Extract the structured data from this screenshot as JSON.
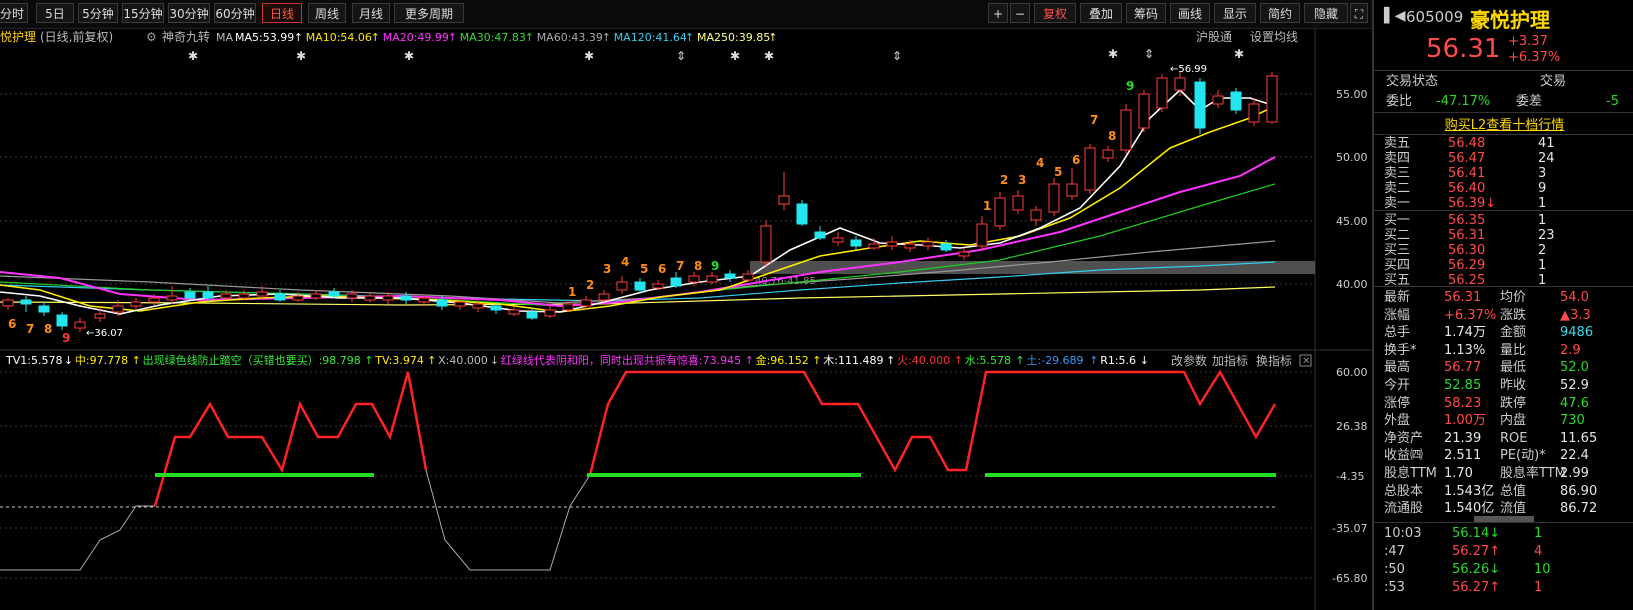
{
  "toolbar": {
    "periods": [
      "分时",
      "5日",
      "5分钟",
      "15分钟",
      "30分钟",
      "60分钟",
      "日线",
      "周线",
      "月线",
      "更多周期"
    ],
    "active_period": "日线",
    "right": [
      "+",
      "−",
      "复权",
      "叠加",
      "筹码",
      "画线",
      "显示",
      "简约",
      "隐藏"
    ]
  },
  "kline_header": {
    "stock": "悦护理",
    "mode": "(日线,前复权)",
    "indicator": "神奇九转",
    "ma_label": "MA",
    "ma_items": [
      {
        "text": "MA5:53.99",
        "color": "#ffffff"
      },
      {
        "text": "MA10:54.06",
        "color": "#ffe600"
      },
      {
        "text": "MA20:49.99",
        "color": "#ff33ff"
      },
      {
        "text": "MA30:47.83",
        "color": "#33dd33"
      },
      {
        "text": "MA60:43.39",
        "color": "#aaaaaa"
      },
      {
        "text": "MA120:41.64",
        "color": "#33ccee"
      },
      {
        "text": "MA250:39.85",
        "color": "#ffff88"
      }
    ],
    "market": "沪股通",
    "settings": "设置均线"
  },
  "price_axis": [
    "55.00",
    "50.00",
    "45.00",
    "40.00"
  ],
  "annotations": {
    "high": "56.99",
    "low": "36.07",
    "zone": "40.76-41.85"
  },
  "nine_top": [
    "1",
    "2",
    "3",
    "4",
    "5",
    "6",
    "7",
    "8",
    "9"
  ],
  "nine_bottom": [
    "6",
    "7",
    "8",
    "9"
  ],
  "indicator_header": [
    {
      "text": "TV1:5.578",
      "color": "#ffffff"
    },
    {
      "text": "中:97.778",
      "color": "#ffee00"
    },
    {
      "text": "出现绿色线防止踏空（买错也要买）:98.798",
      "color": "#33ee33"
    },
    {
      "text": "TV:3.974",
      "color": "#ffee00"
    },
    {
      "text": "X:40.000",
      "color": "#bbbbbb"
    },
    {
      "text": "红绿线代表阴和阳，同时出现共振有惊喜:73.945",
      "color": "#ff33ff"
    },
    {
      "text": "金:96.152",
      "color": "#ffee00"
    },
    {
      "text": "木:111.489",
      "color": "#ffffff"
    },
    {
      "text": "火:40.000",
      "color": "#ff3333"
    },
    {
      "text": "水:5.578",
      "color": "#33ee33"
    },
    {
      "text": "土:-29.689",
      "color": "#3399ff"
    },
    {
      "text": "R1:5.6",
      "color": "#ffffff"
    }
  ],
  "indicator_buttons": [
    "改参数",
    "加指标",
    "换指标"
  ],
  "indicator_axis": [
    "60.00",
    "26.38",
    "-4.35",
    "-35.07",
    "-65.80"
  ],
  "quote": {
    "code": "605009",
    "name": "豪悦护理",
    "price": "56.31",
    "change": "+3.37",
    "change_pct": "+6.37%",
    "status_label": "交易状态",
    "status_value": "交易",
    "weibi_label": "委比",
    "weibi_value": "-47.17%",
    "weicha_label": "委差",
    "weicha_value": "-5",
    "l2_link": "购买L2查看十档行情",
    "sell": [
      {
        "label": "卖五",
        "price": "56.48",
        "vol": "41"
      },
      {
        "label": "卖四",
        "price": "56.47",
        "vol": "24"
      },
      {
        "label": "卖三",
        "price": "56.41",
        "vol": "3"
      },
      {
        "label": "卖二",
        "price": "56.40",
        "vol": "9"
      },
      {
        "label": "卖一",
        "price": "56.39↓",
        "vol": "1"
      }
    ],
    "buy": [
      {
        "label": "买一",
        "price": "56.35",
        "vol": "1"
      },
      {
        "label": "买二",
        "price": "56.31",
        "vol": "23"
      },
      {
        "label": "买三",
        "price": "56.30",
        "vol": "2"
      },
      {
        "label": "买四",
        "price": "56.29",
        "vol": "1"
      },
      {
        "label": "买五",
        "price": "56.25",
        "vol": "1"
      }
    ],
    "stats": [
      {
        "l1": "最新",
        "v1": "56.31",
        "c1": "red",
        "l2": "均价",
        "v2": "54.0",
        "c2": "red"
      },
      {
        "l1": "涨幅",
        "v1": "+6.37%",
        "c1": "red",
        "l2": "涨跌",
        "v2": "▲3.3",
        "c2": "red"
      },
      {
        "l1": "总手",
        "v1": "1.74万",
        "c1": "white",
        "l2": "金额",
        "v2": "9486",
        "c2": "cyan"
      },
      {
        "l1": "换手*",
        "v1": "1.13%",
        "c1": "white",
        "l2": "量比",
        "v2": "2.9",
        "c2": "red"
      },
      {
        "l1": "最高",
        "v1": "56.77",
        "c1": "red",
        "l2": "最低",
        "v2": "52.0",
        "c2": "green"
      },
      {
        "l1": "今开",
        "v1": "52.85",
        "c1": "green",
        "l2": "昨收",
        "v2": "52.9",
        "c2": "white"
      },
      {
        "l1": "涨停",
        "v1": "58.23",
        "c1": "red",
        "l2": "跌停",
        "v2": "47.6",
        "c2": "green"
      },
      {
        "l1": "外盘",
        "v1": "1.00万",
        "c1": "red",
        "l2": "内盘",
        "v2": "730",
        "c2": "green"
      },
      {
        "l1": "净资产",
        "v1": "21.39",
        "c1": "white",
        "l2": "ROE",
        "v2": "11.65",
        "c2": "white"
      },
      {
        "l1": "收益㈣",
        "v1": "2.511",
        "c1": "white",
        "l2": "PE(动)*",
        "v2": "22.4",
        "c2": "white"
      },
      {
        "l1": "股息TTM",
        "v1": "1.70",
        "c1": "white",
        "l2": "股息率TTM",
        "v2": "2.99",
        "c2": "white"
      },
      {
        "l1": "总股本",
        "v1": "1.543亿",
        "c1": "white",
        "l2": "总值",
        "v2": "86.90",
        "c2": "white"
      },
      {
        "l1": "流通股",
        "v1": "1.540亿",
        "c1": "white",
        "l2": "流值",
        "v2": "86.72",
        "c2": "white"
      }
    ],
    "ticks": [
      {
        "time": "10:03",
        "price": "56.14↓",
        "vol": "1",
        "pc": "green"
      },
      {
        "time": ":47",
        "price": "56.27↑",
        "vol": "4",
        "pc": "red"
      },
      {
        "time": ":50",
        "price": "56.26↓",
        "vol": "10",
        "pc": "green"
      },
      {
        "time": ":53",
        "price": "56.27↑",
        "vol": "1",
        "pc": "red"
      }
    ]
  }
}
